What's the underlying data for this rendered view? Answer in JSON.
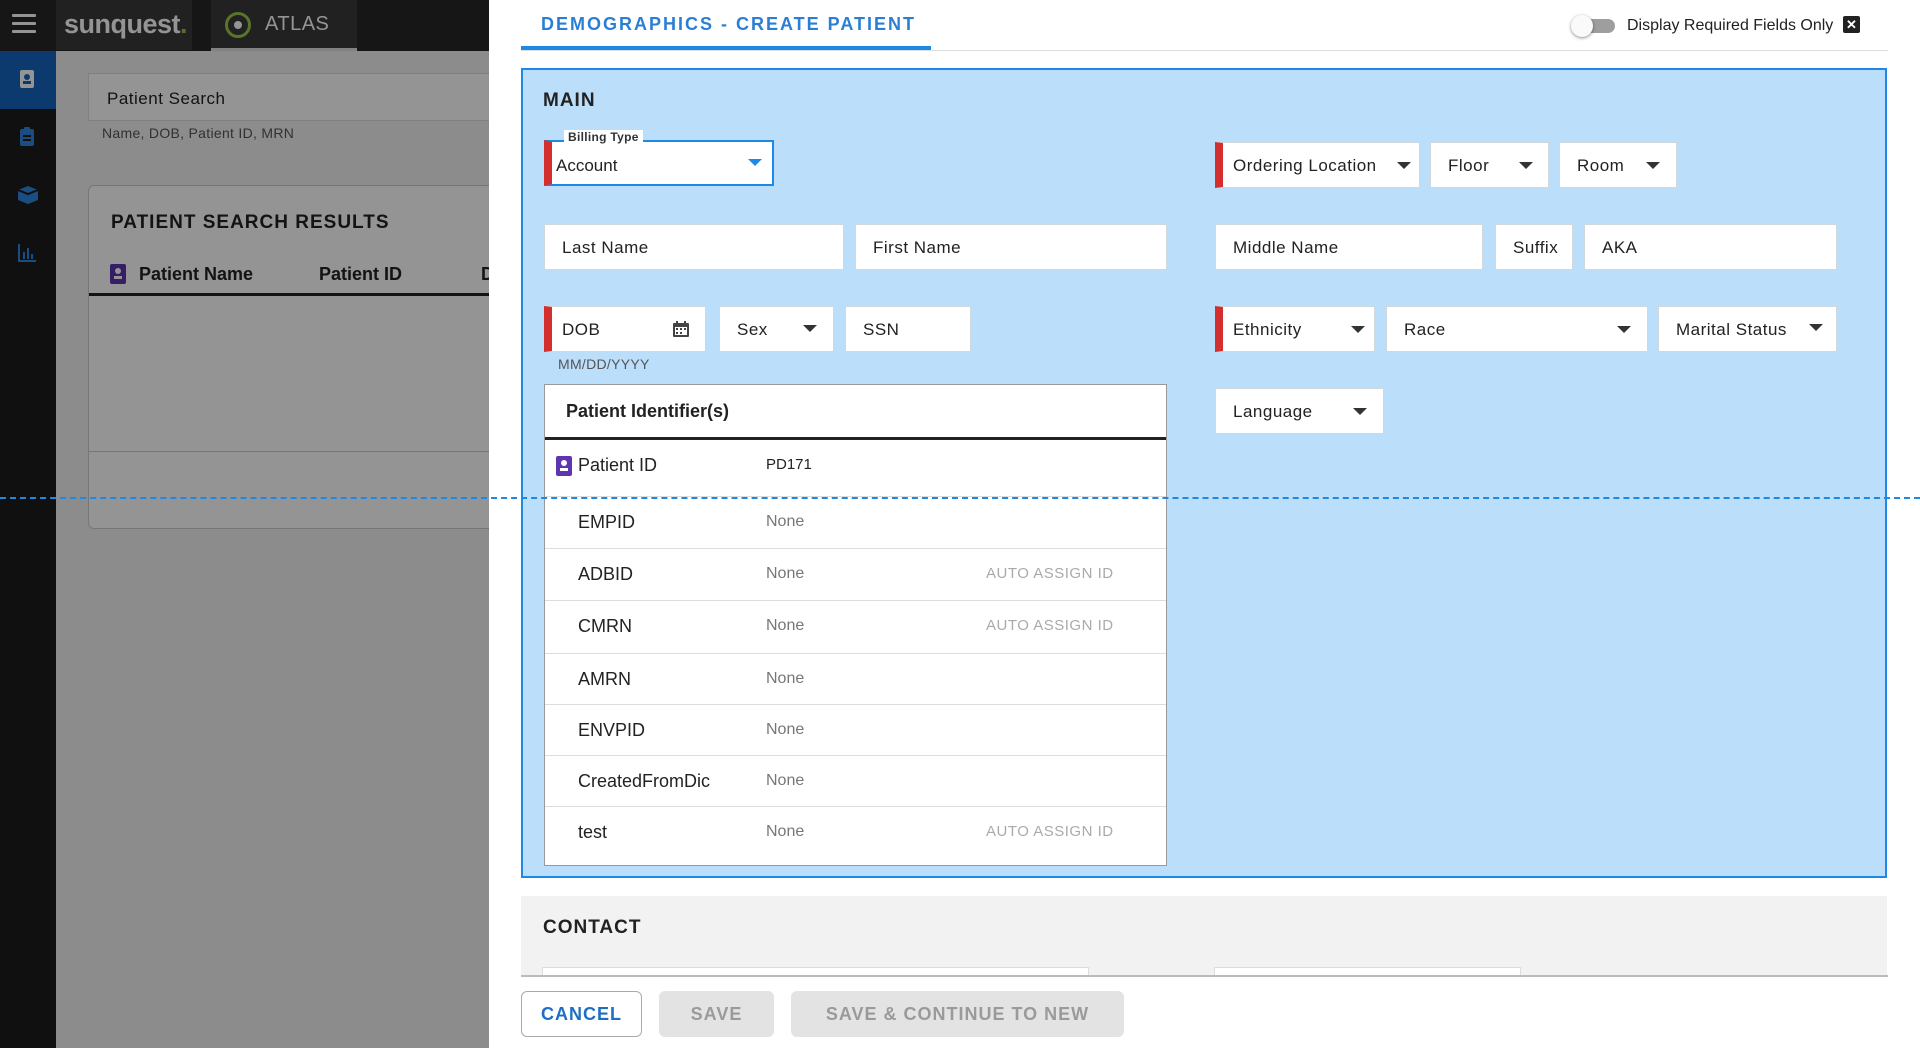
{
  "app": {
    "logo_text": "sunquest",
    "logo_dot": ".",
    "atlas_tab": "ATLAS"
  },
  "search": {
    "placeholder": "Patient Search",
    "hint": "Name, DOB, Patient ID, MRN"
  },
  "results": {
    "title": "PATIENT SEARCH RESULTS",
    "columns": [
      "Patient Name",
      "Patient ID",
      "D"
    ]
  },
  "modal": {
    "tab_title": "DEMOGRAPHICS - CREATE PATIENT",
    "toggle_label": "Display Required Fields Only",
    "close_glyph": "✕"
  },
  "main": {
    "title": "MAIN",
    "billing_type": {
      "label": "Billing Type",
      "value": "Account"
    },
    "ordering_location": "Ordering Location",
    "floor": "Floor",
    "room": "Room",
    "last_name": "Last Name",
    "first_name": "First Name",
    "middle_name": "Middle Name",
    "suffix": "Suffix",
    "aka": "AKA",
    "dob": "DOB",
    "dob_hint": "MM/DD/YYYY",
    "sex": "Sex",
    "ssn": "SSN",
    "ethnicity": "Ethnicity",
    "race": "Race",
    "marital_status": "Marital Status",
    "language": "Language"
  },
  "identifiers": {
    "title": "Patient Identifier(s)",
    "rows": [
      {
        "name": "Patient ID",
        "value": "PD171",
        "action": ""
      },
      {
        "name": "EMPID",
        "value": "None",
        "action": ""
      },
      {
        "name": "ADBID",
        "value": "None",
        "action": "AUTO ASSIGN ID"
      },
      {
        "name": "CMRN",
        "value": "None",
        "action": "AUTO ASSIGN ID"
      },
      {
        "name": "AMRN",
        "value": "None",
        "action": ""
      },
      {
        "name": "ENVPID",
        "value": "None",
        "action": ""
      },
      {
        "name": "CreatedFromDic",
        "value": "None",
        "action": ""
      },
      {
        "name": "test",
        "value": "None",
        "action": "AUTO ASSIGN ID"
      }
    ]
  },
  "contact": {
    "title": "CONTACT"
  },
  "footer": {
    "cancel": "CANCEL",
    "save": "SAVE",
    "save_continue": "SAVE & CONTINUE TO NEW ORDER"
  },
  "colors": {
    "accent": "#1e88e5",
    "required": "#d32f2f",
    "section_bg": "#bbdefb",
    "brand_green": "#8cc63f"
  }
}
